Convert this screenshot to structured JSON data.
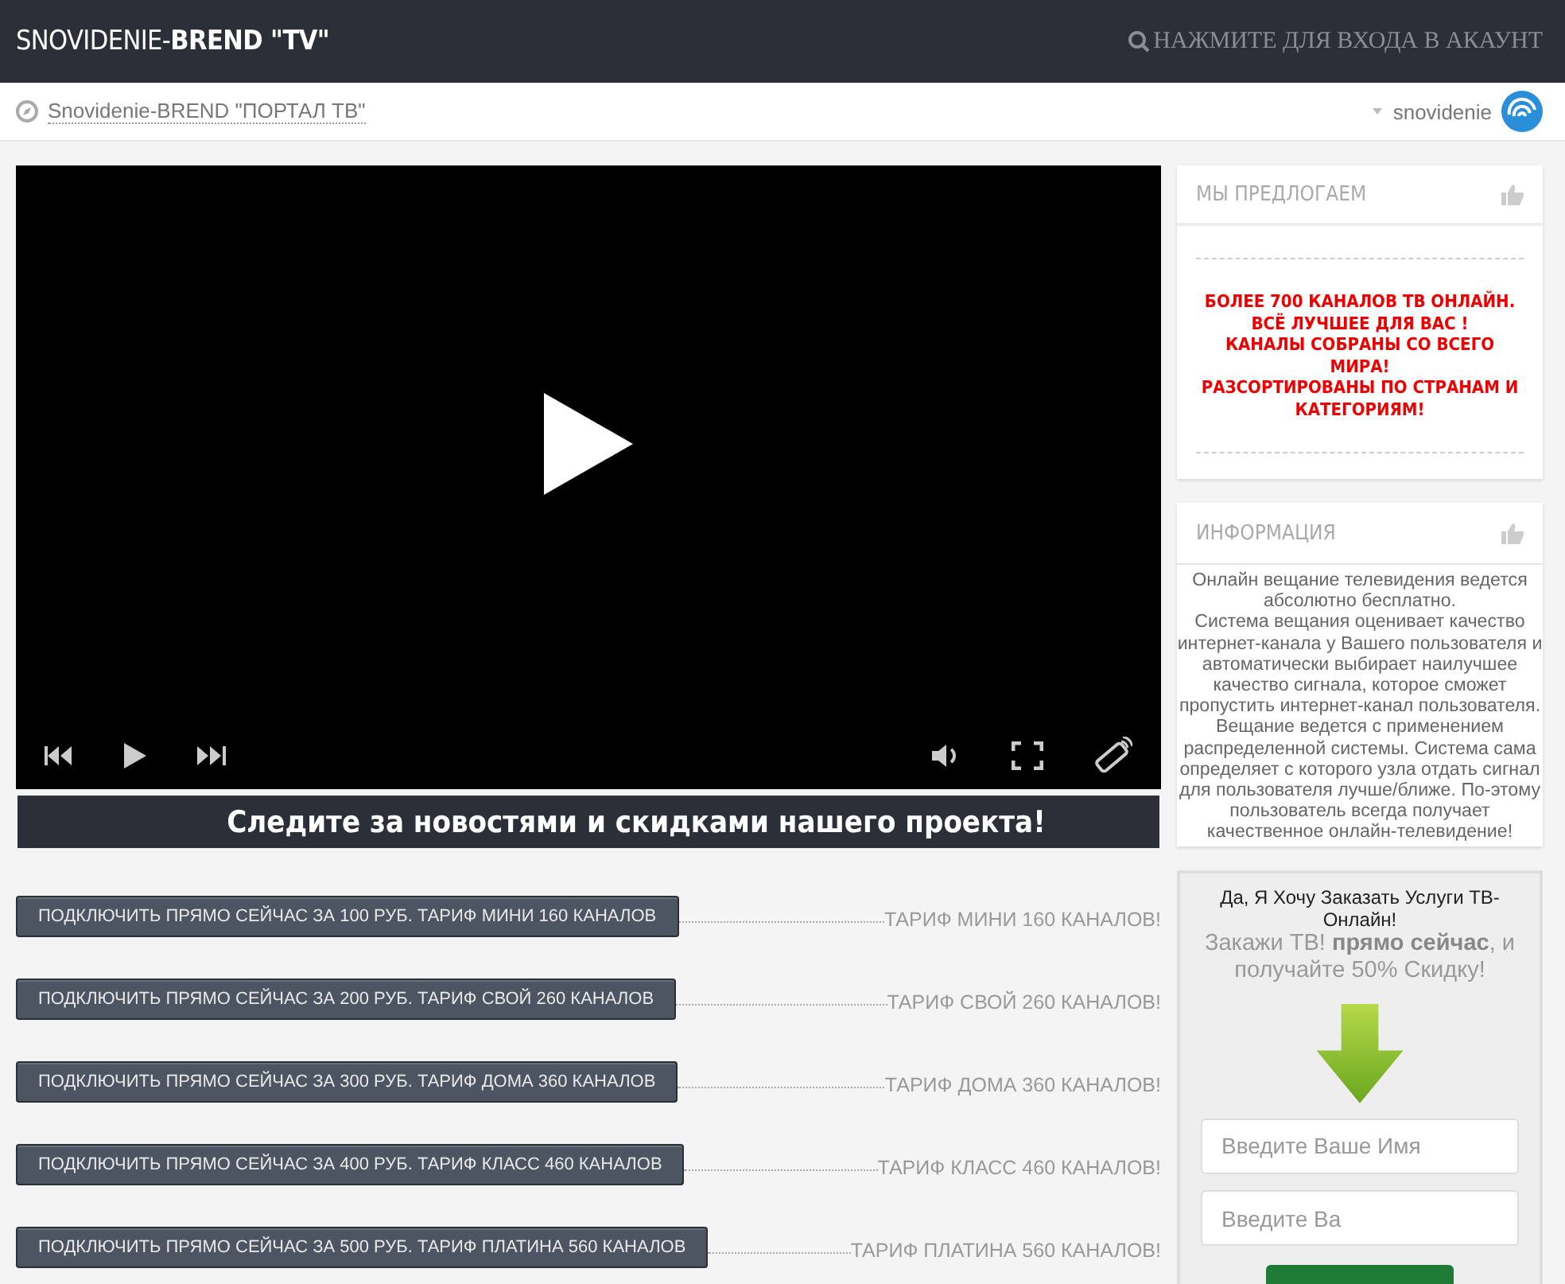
{
  "header": {
    "logo": "SNOVIDENIE-**BREND \"TV\"**",
    "login": "НАЖМИТЕ ДЛЯ ВХОДА В АКАУНТ"
  },
  "breadcrumb": {
    "link": "Snovidenie-BREND \"ПОРТАЛ ТВ\"",
    "user": "snovidenie"
  },
  "banner": "Следите за новостями и скидками нашего проекта!",
  "tariffs": [
    {
      "button": "ПОДКЛЮЧИТЬ ПРЯМО СЕЙЧАС ЗА 100 РУБ. ТАРИФ МИНИ 160 КАНАЛОВ",
      "label": "ТАРИФ МИНИ 160 КАНАЛОВ!"
    },
    {
      "button": "ПОДКЛЮЧИТЬ ПРЯМО СЕЙЧАС ЗА 200 РУБ. ТАРИФ СВОЙ 260 КАНАЛОВ",
      "label": "ТАРИФ СВОЙ 260 КАНАЛОВ!"
    },
    {
      "button": "ПОДКЛЮЧИТЬ ПРЯМО СЕЙЧАС ЗА 300 РУБ. ТАРИФ ДОМА 360 КАНАЛОВ",
      "label": "ТАРИФ ДОМА 360 КАНАЛОВ!"
    },
    {
      "button": "ПОДКЛЮЧИТЬ ПРЯМО СЕЙЧАС ЗА 400 РУБ. ТАРИФ КЛАСС 460 КАНАЛОВ",
      "label": "ТАРИФ КЛАСС 460 КАНАЛОВ!"
    },
    {
      "button": "ПОДКЛЮЧИТЬ ПРЯМО СЕЙЧАС ЗА 500 РУБ. ТАРИФ ПЛАТИНА 560 КАНАЛОВ",
      "label": "ТАРИФ ПЛАТИНА 560 КАНАЛОВ!"
    }
  ],
  "offer": {
    "title": "МЫ ПРЕДЛОГАЕМ",
    "lines": [
      "БОЛЕЕ 700 КАНАЛОВ ТВ ОНЛАЙН.",
      "ВСЁ ЛУЧШЕЕ ДЛЯ ВАС !",
      "КАНАЛЫ СОБРАНЫ СО ВСЕГО МИРА!",
      "РАЗСОРТИРОВАНЫ ПО СТРАНАМ И КАТЕГОРИЯМ!"
    ]
  },
  "info": {
    "title": "ИНФОРМАЦИЯ",
    "paragraphs": [
      "Онлайн вещание телевидения ведется абсолютно бесплатно.",
      "Система вещания оценивает качество интернет-канала у Вашего пользователя и автоматически выбирает наилучшее качество сигнала, которое сможет пропустить интернет-канал пользователя. Вещание ведется с применением распределенной системы. Система сама определяет с которого узла отдать сигнал для пользователя лучше/ближе. По-этому пользователь всегда получает качественное онлайн-телевидение!"
    ]
  },
  "order": {
    "heading": "Да, Я Хочу Заказать Услуги ТВ-Онлайн!",
    "promo": "Закажи ТВ! **прямо сейчас**, и получайте 50% Скидку!",
    "fields": [
      {
        "placeholder": "Введите Ваше Имя"
      },
      {
        "placeholder": "Введите Ва"
      }
    ]
  }
}
